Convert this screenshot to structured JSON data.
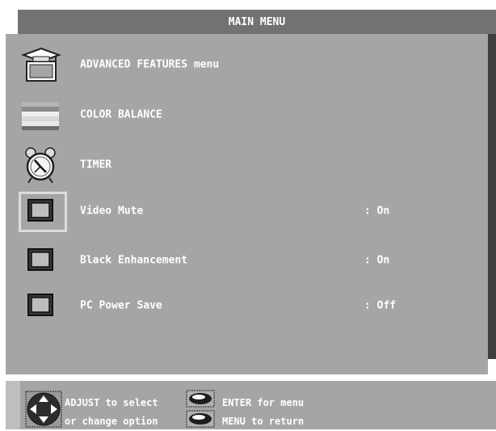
{
  "title": "MAIN MENU",
  "items": [
    {
      "label": "ADVANCED FEATURES menu",
      "icon": "graduation-cap-tv-icon"
    },
    {
      "label": "COLOR BALANCE",
      "icon": "color-bars-icon"
    },
    {
      "label": "TIMER",
      "icon": "alarm-clock-icon"
    },
    {
      "label": "Video Mute",
      "value": ": On",
      "icon": "checkbox-icon",
      "selected": true
    },
    {
      "label": "Black Enhancement",
      "value": ": On",
      "icon": "checkbox-icon"
    },
    {
      "label": "PC Power Save",
      "value": ": Off",
      "icon": "checkbox-icon"
    }
  ],
  "footer": {
    "adjust_line1": "ADJUST to select",
    "adjust_line2": "or change option",
    "enter_label": "ENTER for menu",
    "menu_label": "MENU to return",
    "icons": [
      "dpad-icon",
      "enter-button-icon",
      "menu-button-icon"
    ]
  },
  "colors": {
    "panel": "#a5a5a5",
    "title_bar": "#727272",
    "shadow": "#3f3f3f",
    "text": "#ffffff",
    "selection_frame": "#dcdcdc"
  }
}
